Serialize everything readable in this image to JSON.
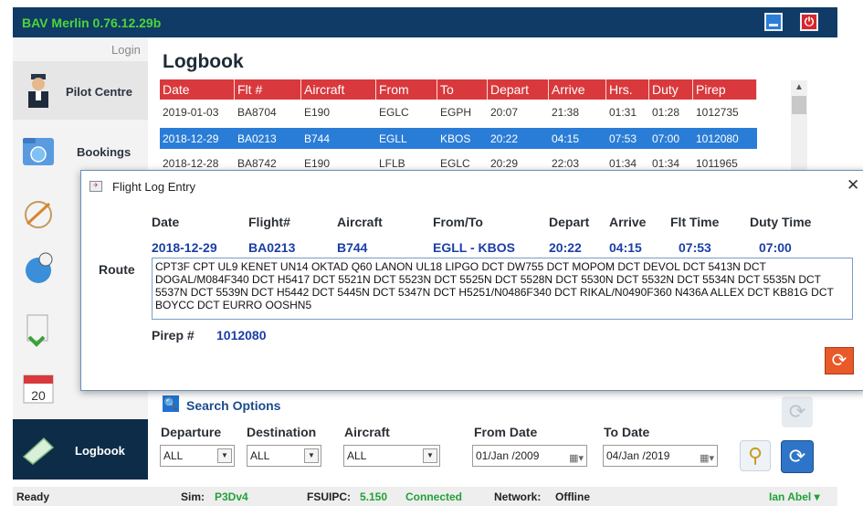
{
  "app": {
    "title": "BAV Merlin 0.76.12.29b"
  },
  "nav": {
    "login": "Login",
    "items": [
      {
        "label": "Pilot Centre"
      },
      {
        "label": "Bookings"
      },
      {
        "label": "Logbook"
      }
    ]
  },
  "logbook": {
    "title": "Logbook",
    "columns": [
      "Date",
      "Flt #",
      "Aircraft",
      "From",
      "To",
      "Depart",
      "Arrive",
      "Hrs.",
      "Duty",
      "Pirep"
    ],
    "rows": [
      [
        "2019-01-03",
        "BA8704",
        "E190",
        "EGLC",
        "EGPH",
        "20:07",
        "21:38",
        "01:31",
        "01:28",
        "1012735"
      ],
      [
        "2018-12-29",
        "BA0213",
        "B744",
        "EGLL",
        "KBOS",
        "20:22",
        "04:15",
        "07:53",
        "07:00",
        "1012080"
      ],
      [
        "2018-12-28",
        "BA8742",
        "E190",
        "LFLB",
        "EGLC",
        "20:29",
        "22:03",
        "01:34",
        "01:34",
        "1011965"
      ]
    ]
  },
  "dialog": {
    "title": "Flight Log Entry",
    "headers": {
      "date": "Date",
      "flight": "Flight#",
      "aircraft": "Aircraft",
      "fromto": "From/To",
      "depart": "Depart",
      "arrive": "Arrive",
      "flttime": "Flt Time",
      "dutytime": "Duty Time"
    },
    "values": {
      "date": "2018-12-29",
      "flight": "BA0213",
      "aircraft": "B744",
      "fromto": "EGLL - KBOS",
      "depart": "20:22",
      "arrive": "04:15",
      "flttime": "07:53",
      "dutytime": "07:00"
    },
    "route_label": "Route",
    "route": "CPT3F CPT UL9 KENET UN14 OKTAD Q60 LANON UL18 LIPGO DCT DW755 DCT MOPOM DCT DEVOL DCT 5413N DCT DOGAL/M084F340 DCT H5417 DCT 5521N DCT 5523N DCT 5525N DCT 5528N DCT 5530N DCT 5532N DCT 5534N DCT 5535N DCT 5537N DCT 5539N DCT H5442 DCT 5445N DCT 5347N DCT H5251/N0486F340 DCT RIKAL/N0490F360 N436A ALLEX DCT KB81G DCT BOYCC DCT EURRO OOSHN5",
    "pirep_label": "Pirep #",
    "pirep": "1012080"
  },
  "search": {
    "title": "Search Options",
    "departure_label": "Departure",
    "destination_label": "Destination",
    "aircraft_label": "Aircraft",
    "fromdate_label": "From Date",
    "todate_label": "To Date",
    "departure": "ALL",
    "destination": "ALL",
    "aircraft": "ALL",
    "from_date": "01/Jan /2009",
    "to_date": "04/Jan /2019"
  },
  "status": {
    "ready": "Ready",
    "sim_label": "Sim:",
    "sim": "P3Dv4",
    "fsuipc_label": "FSUIPC:",
    "fsuipc": "5.150",
    "connected": "Connected",
    "network_label": "Network:",
    "network": "Offline",
    "user": "Ian Abel"
  },
  "colors": {
    "header": "#d9393c",
    "selected": "#2a7dd6",
    "titlebar": "#0f3b66",
    "brand_green": "#4dd53a"
  }
}
